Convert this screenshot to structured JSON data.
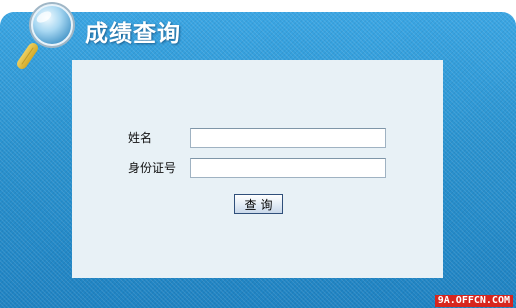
{
  "header": {
    "title": "成绩查询"
  },
  "form": {
    "name_label": "姓名",
    "name_value": "",
    "id_label": "身份证号",
    "id_value": "",
    "submit_label": "查询"
  },
  "watermark": "9A.OFFCN.COM",
  "icons": {
    "header_icon": "magnifier-icon"
  },
  "colors": {
    "panel_blue": "#2a93d0",
    "content_bg": "#e8f1f6",
    "watermark_red": "#d7261e"
  }
}
